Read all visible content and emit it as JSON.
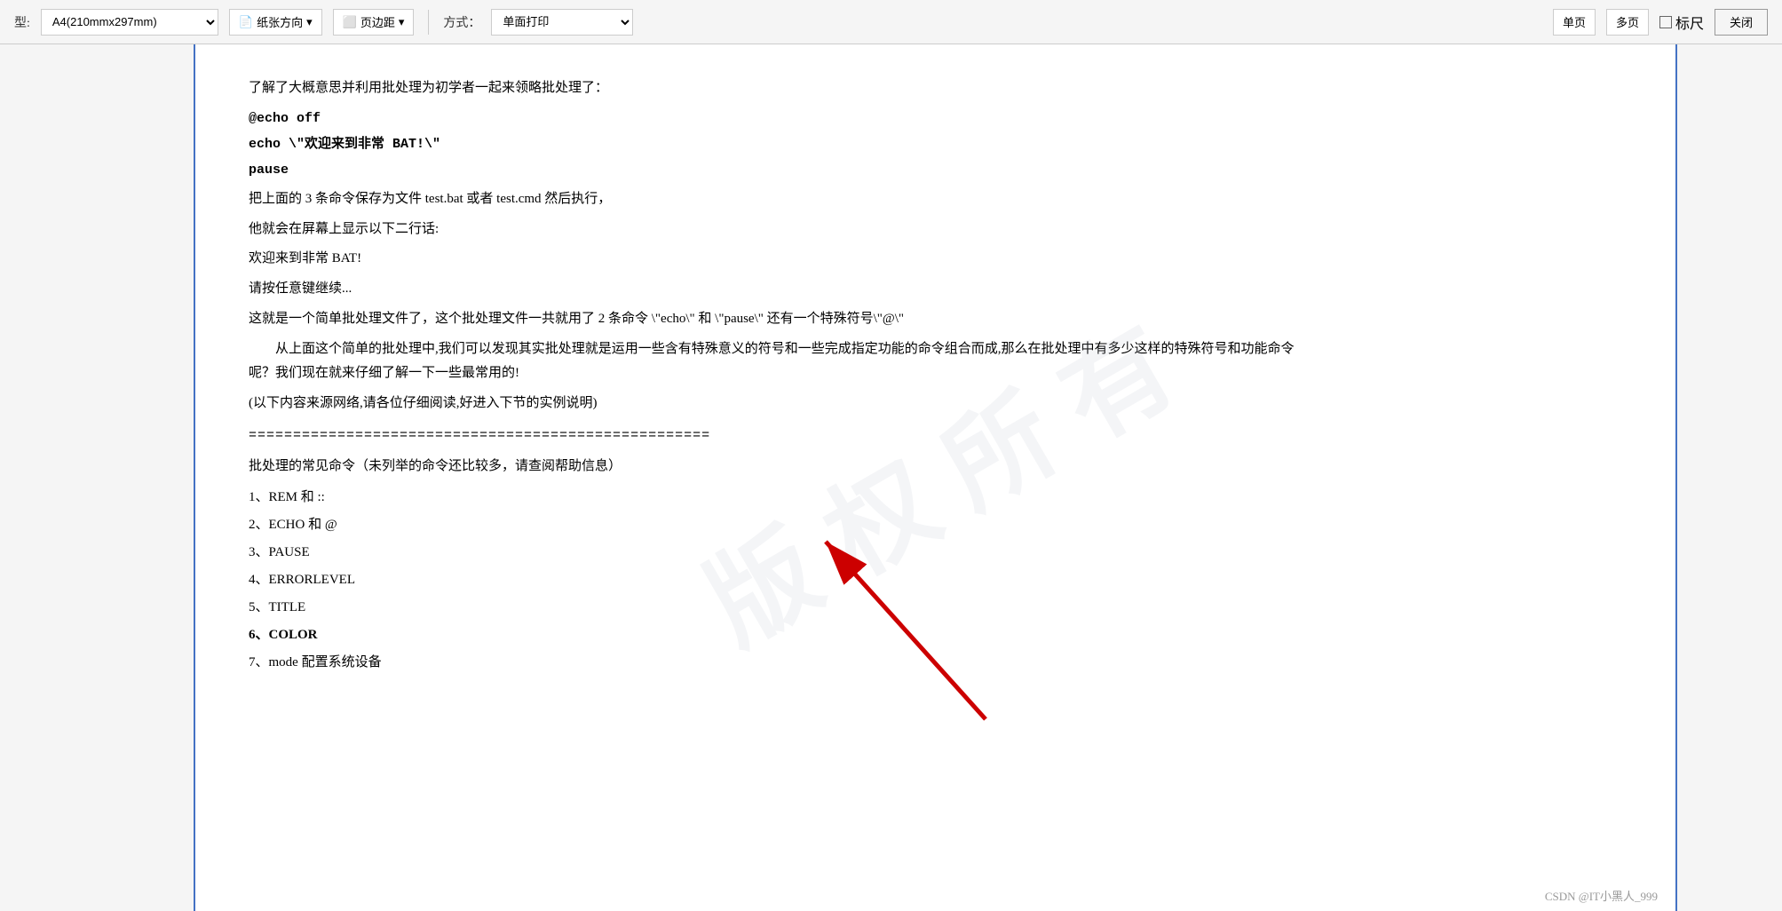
{
  "toolbar": {
    "type_label": "型:",
    "paper_size": "A4(210mmx297mm)",
    "paper_direction_label": "纸张方向",
    "margin_label": "页边距",
    "method_label": "方式：",
    "print_method": "单面打印",
    "single_page_label": "单页",
    "multi_page_label": "多页",
    "ruler_label": "标尺",
    "close_label": "关闭"
  },
  "document": {
    "watermark_text": "版权所有",
    "content": {
      "line1": "了解了大概意思并利用批处理为初学者一起来领略批处理了：",
      "code1": "@echo off",
      "code2": "echo \\\"欢迎来到非常 BAT!\\\"",
      "code3": "pause",
      "para1": "把上面的 3 条命令保存为文件 test.bat 或者 test.cmd 然后执行，",
      "para2": "他就会在屏幕上显示以下二行话:",
      "para3": "欢迎来到非常 BAT!",
      "para4": "请按任意键继续...",
      "para5": "这就是一个简单批处理文件了，这个批处理文件一共就用了 2 条命令  \\\"echo\\\" 和 \\\"pause\\\" 还有一个特殊符号\\\"@\\\"",
      "para6_indent": "从上面这个简单的批处理中,我们可以发现其实批处理就是运用一些含有特殊意义的符号和一些完成指定功能的命令组合而成,那么在批处理中有多少这样的特殊符号和功能命令呢？我们现在就来仔细了解一下一些最常用的!",
      "para7": "(以下内容来源网络,请各位仔细阅读,好进入下节的实例说明)",
      "separator": "====================================================",
      "section_title": "批处理的常见命令（未列举的命令还比较多，请查阅帮助信息）",
      "list_items": [
        "1、REM 和 ::",
        "2、ECHO 和 @",
        "3、PAUSE",
        "4、ERRORLEVEL",
        "5、TITLE",
        "6、COLOR",
        "7、mode 配置系统设备"
      ]
    }
  },
  "bottom_watermark": "CSDN @IT小黑人_999",
  "icons": {
    "paper_direction": "📄",
    "margin": "⬜",
    "checkbox": "☐"
  }
}
